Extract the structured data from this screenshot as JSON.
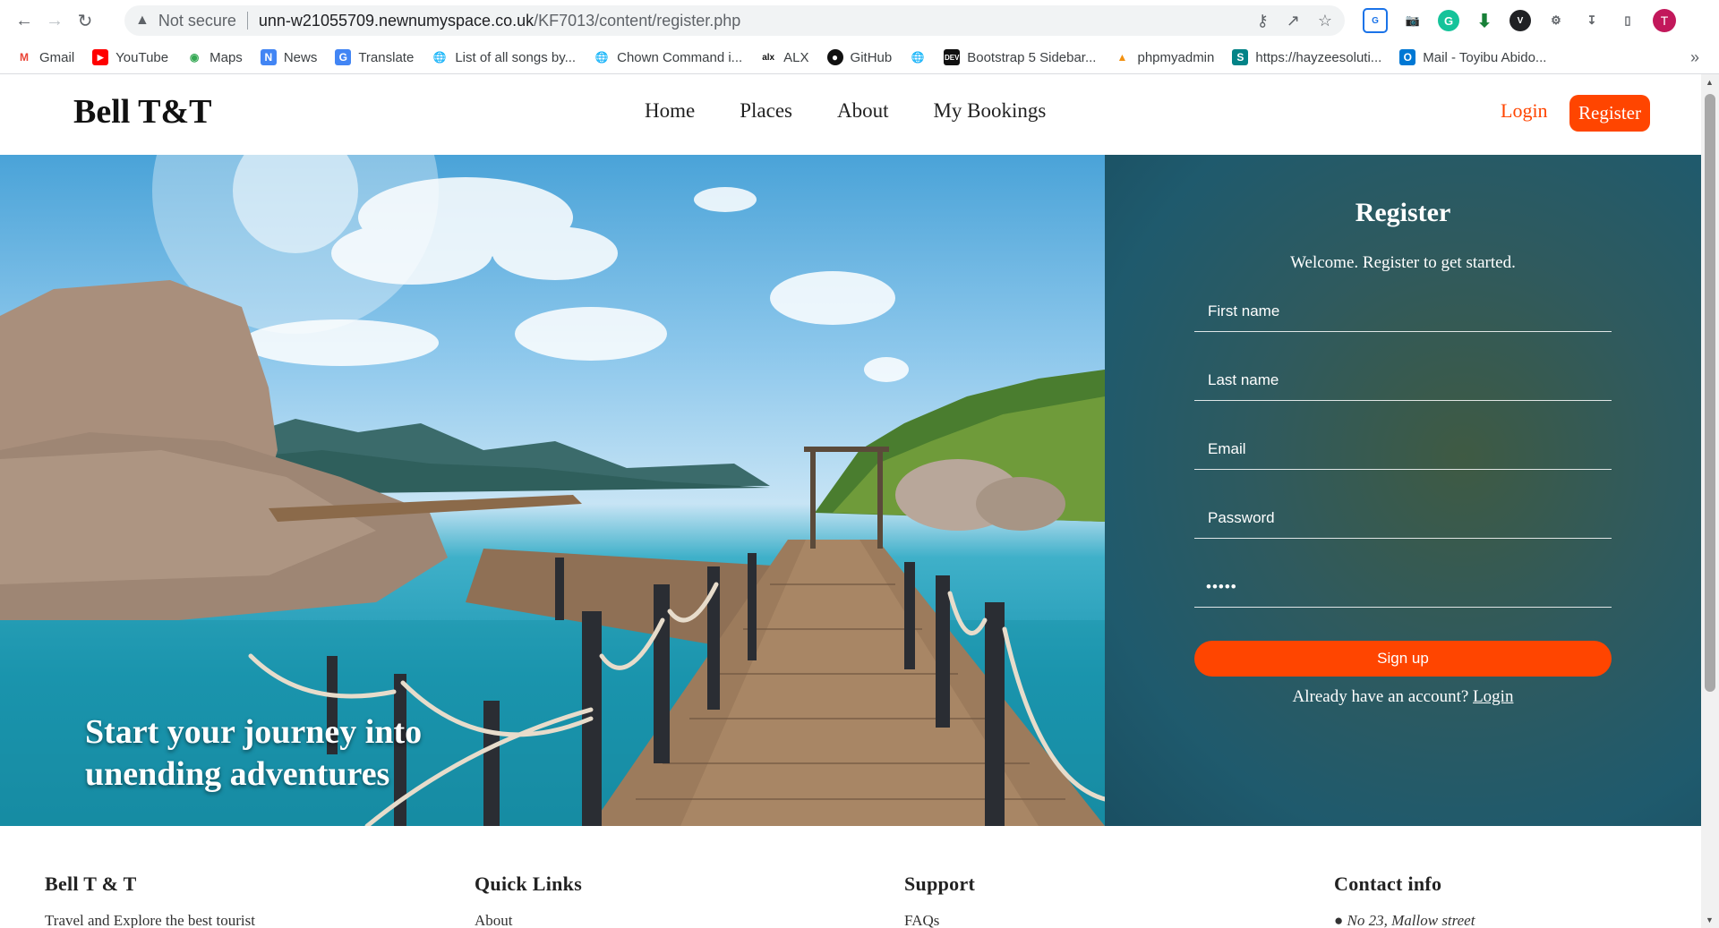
{
  "browser": {
    "not_secure": "Not secure",
    "url_host": "unn-w21055709.newnumyspace.co.uk",
    "url_path": "/KF7013/content/register.php",
    "avatar_letter": "T"
  },
  "bookmarks": [
    {
      "label": "Gmail",
      "icon": "gmail-icon"
    },
    {
      "label": "YouTube",
      "icon": "youtube-icon"
    },
    {
      "label": "Maps",
      "icon": "maps-icon"
    },
    {
      "label": "News",
      "icon": "news-icon"
    },
    {
      "label": "Translate",
      "icon": "translate-icon"
    },
    {
      "label": "List of all songs by...",
      "icon": "globe-icon"
    },
    {
      "label": "Chown Command i...",
      "icon": "globe-icon"
    },
    {
      "label": "ALX",
      "icon": "alx-icon"
    },
    {
      "label": "GitHub",
      "icon": "github-icon"
    },
    {
      "label": "",
      "icon": "globe-icon"
    },
    {
      "label": "Bootstrap 5 Sidebar...",
      "icon": "dev-icon"
    },
    {
      "label": "phpmyadmin",
      "icon": "phpmyadmin-icon"
    },
    {
      "label": "https://hayzeesoluti...",
      "icon": "sharepoint-icon"
    },
    {
      "label": "Mail - Toyibu Abido...",
      "icon": "outlook-icon"
    }
  ],
  "site": {
    "brand": "Bell T&T",
    "nav": [
      "Home",
      "Places",
      "About",
      "My Bookings"
    ],
    "login": "Login",
    "register": "Register"
  },
  "hero": {
    "tagline": "Start your journey into unending adventures"
  },
  "form": {
    "title": "Register",
    "subtitle": "Welcome. Register to get started.",
    "first_name_placeholder": "First name",
    "last_name_placeholder": "Last name",
    "email_placeholder": "Email",
    "password_placeholder": "Password",
    "confirm_value": "•••••",
    "signup": "Sign up",
    "already_text": "Already have an account?",
    "login_link": "Login"
  },
  "footer": {
    "col1_title": "Bell T & T",
    "col1_text": "Travel and Explore the best tourist",
    "col2_title": "Quick Links",
    "col2_text": "About",
    "col3_title": "Support",
    "col3_text": "FAQs",
    "col4_title": "Contact info",
    "col4_text": "No 23, Mallow street"
  },
  "colors": {
    "accent": "#ff4500",
    "panel": "#1f5a6d"
  }
}
